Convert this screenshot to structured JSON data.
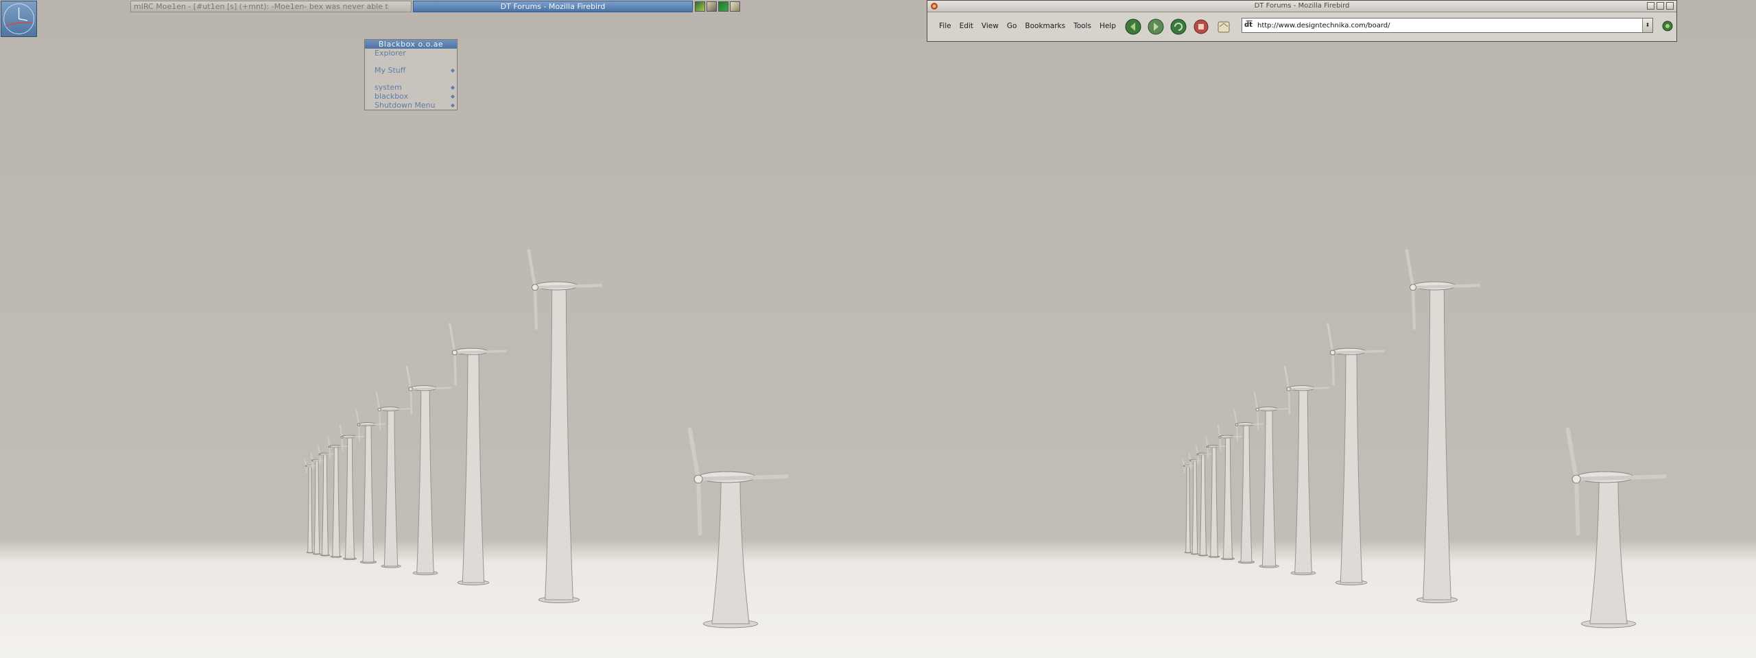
{
  "left_screen": {
    "clock": {
      "icon": "analog-clock-icon"
    },
    "taskbar": {
      "tasks": [
        {
          "label": "mIRC Moe1en - [#ut1en [s] (+mnt): -Moe1en- bex was never able t"
        },
        {
          "label": "DT Forums - Mozilla Firebird"
        }
      ],
      "tray_icons": [
        "network-icon",
        "wrench-icon",
        "app-icon",
        "settings-icon"
      ]
    },
    "root_menu": {
      "title": "Blackbox o.o.ae",
      "items": [
        {
          "label": "Explorer",
          "has_submenu": false
        },
        {
          "label": "My Stuff",
          "has_submenu": true
        },
        {
          "label": "system",
          "has_submenu": true
        },
        {
          "label": "blackbox",
          "has_submenu": true
        },
        {
          "label": "Shutdown Menu",
          "has_submenu": true
        }
      ]
    }
  },
  "right_screen": {
    "browser": {
      "title": "DT Forums - Mozilla Firebird",
      "menu": [
        "File",
        "Edit",
        "View",
        "Go",
        "Bookmarks",
        "Tools",
        "Help"
      ],
      "nav_buttons": [
        "back-icon",
        "forward-icon",
        "reload-icon",
        "stop-icon",
        "home-icon"
      ],
      "url": "http://www.designtechnika.com/board/"
    }
  },
  "colors": {
    "sky": "#bcb7b0",
    "ground": "#f1efeb",
    "accent": "#5b7fae"
  }
}
